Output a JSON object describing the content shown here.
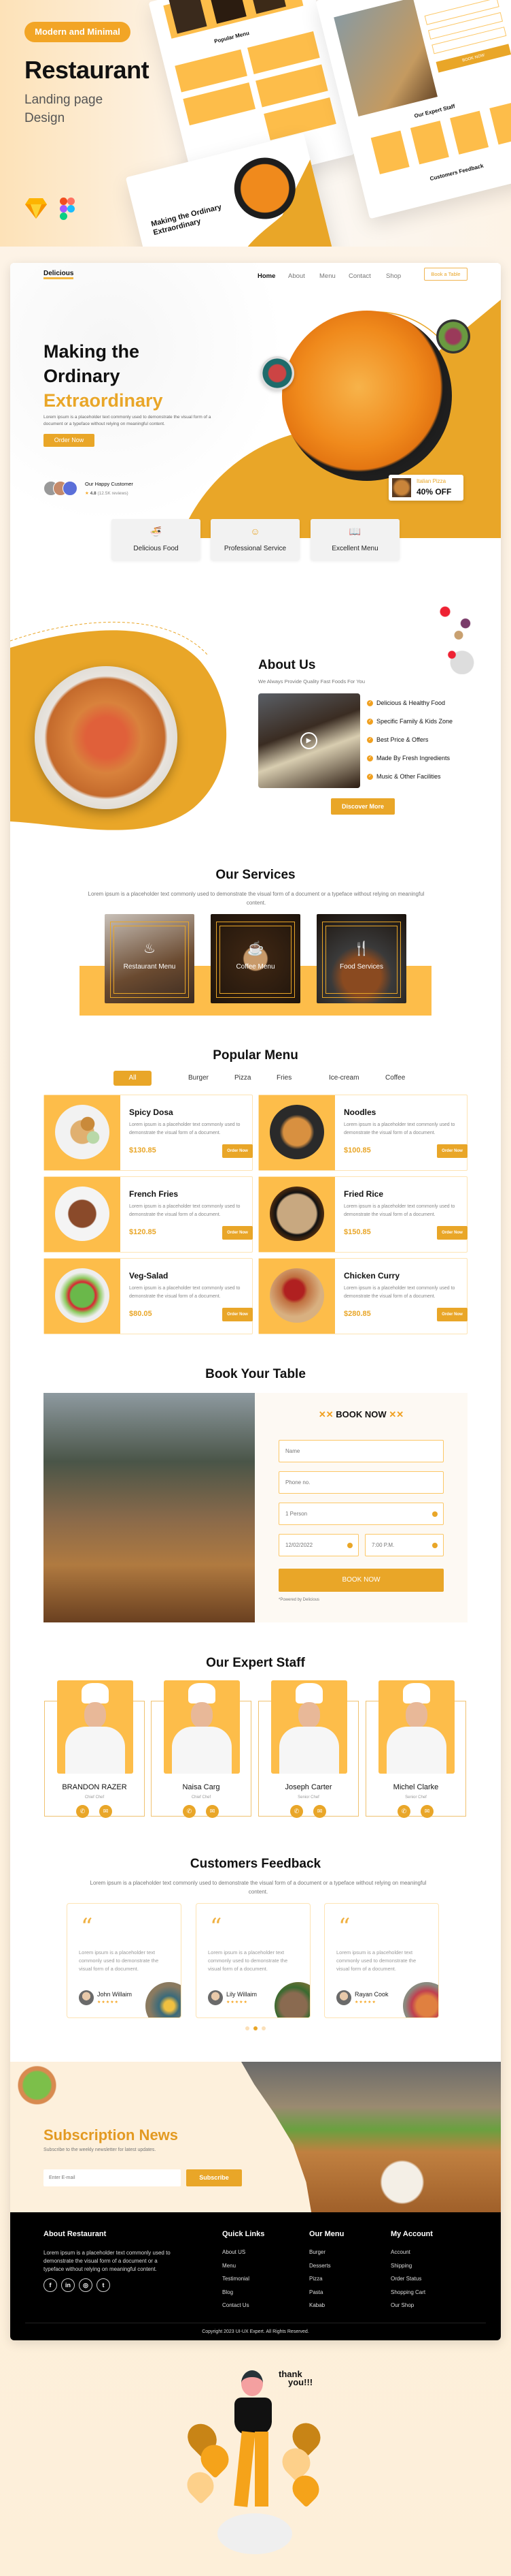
{
  "banner": {
    "badge": "Modern and Minimal",
    "title": "Restaurant",
    "subtitle_line1": "Landing page",
    "subtitle_line2": "Design",
    "tool_icons": [
      "sketch-icon",
      "figma-icon"
    ],
    "mockup_labels": {
      "popular_menu": "Popular Menu",
      "expert_staff": "Our Expert Staff",
      "feedback": "Customers Feedback",
      "book_now": "BOOK NOW",
      "hero": "Making the Ordinary Extraordinary"
    }
  },
  "colors": {
    "accent": "#e9a628",
    "yellow": "#fdbd4a",
    "cream": "#fdf1e0",
    "footer": "#000000"
  },
  "nav": {
    "logo": "Delicious",
    "links": [
      "Home",
      "About",
      "Menu",
      "Contact",
      "Shop"
    ],
    "active": "Home",
    "cta": "Book a Table"
  },
  "hero": {
    "title_line1": "Making the",
    "title_line2": "Ordinary",
    "title_highlight": "Extraordinary",
    "description": "Lorem ipsum is a placeholder text commonly used to demonstrate the visual form of a document or a typeface without relying on meaningful content.",
    "cta": "Order Now",
    "customers_label": "Our Happy Customer",
    "rating": "4.8",
    "reviews": "(12.5K reviews)",
    "promo_title": "Italian Pizza",
    "promo_discount": "40% OFF",
    "features": [
      {
        "label": "Delicious Food",
        "icon": "noodle-bowl-icon"
      },
      {
        "label": "Professional Service",
        "icon": "waiter-icon"
      },
      {
        "label": "Excellent Menu",
        "icon": "menu-book-icon"
      }
    ]
  },
  "about": {
    "title": "About Us",
    "subtitle": "We Always Provide Quality Fast Foods For You",
    "points": [
      "Delicious & Healthy Food",
      "Specific Family & Kids Zone",
      "Best Price & Offers",
      "Made By Fresh Ingredients",
      "Music & Other Facilities"
    ],
    "cta": "Discover More"
  },
  "services": {
    "title": "Our Services",
    "description": "Lorem ipsum is a placeholder text commonly used to demonstrate the visual form of a document or a typeface without relying on meaningful content.",
    "items": [
      {
        "label": "Restaurant Menu",
        "icon": "serving-dish-icon"
      },
      {
        "label": "Coffee Menu",
        "icon": "coffee-cup-icon"
      },
      {
        "label": "Food Services",
        "icon": "fork-knife-icon"
      }
    ]
  },
  "menu": {
    "title": "Popular Menu",
    "tabs": [
      "All",
      "Burger",
      "Pizza",
      "Fries",
      "Ice-cream",
      "Coffee"
    ],
    "active_tab": "All",
    "order_label": "Order Now",
    "items": [
      {
        "name": "Spicy Dosa",
        "description": "Lorem ipsum is a placeholder text commonly used to demonstrate the visual form of a document.",
        "price": "$130.85"
      },
      {
        "name": "Noodles",
        "description": "Lorem ipsum is a placeholder text commonly used to demonstrate the visual form of a document.",
        "price": "$100.85"
      },
      {
        "name": "French Fries",
        "description": "Lorem ipsum is a placeholder text commonly used to demonstrate the visual form of a document.",
        "price": "$120.85"
      },
      {
        "name": "Fried Rice",
        "description": "Lorem ipsum is a placeholder text commonly used to demonstrate the visual form of a document.",
        "price": "$150.85"
      },
      {
        "name": "Veg-Salad",
        "description": "Lorem ipsum is a placeholder text commonly used to demonstrate the visual form of a document.",
        "price": "$80.05"
      },
      {
        "name": "Chicken Curry",
        "description": "Lorem ipsum is a placeholder text commonly used to demonstrate the visual form of a document.",
        "price": "$280.85"
      }
    ]
  },
  "booking": {
    "title": "Book Your Table",
    "form_title": "BOOK NOW",
    "name_placeholder": "Name",
    "phone_placeholder": "Phone no.",
    "persons": "1 Person",
    "date": "12/02/2022",
    "time": "7:00 P.M.",
    "submit": "BOOK NOW",
    "powered": "*Powered by Delicious"
  },
  "staff": {
    "title": "Our Expert Staff",
    "members": [
      {
        "name": "BRANDON RAZER",
        "role": "Chief Chef"
      },
      {
        "name": "Naisa Carg",
        "role": "Chief Chef"
      },
      {
        "name": "Joseph Carter",
        "role": "Senior Chef"
      },
      {
        "name": "Michel Clarke",
        "role": "Senior Chef"
      }
    ]
  },
  "feedback": {
    "title": "Customers Feedback",
    "description": "Lorem ipsum is a placeholder text commonly used to demonstrate the visual form of a document or a typeface without relying on meaningful content.",
    "reviews": [
      {
        "text": "Lorem ipsum is a placeholder text commonly used to demonstrate the visual form of a document.",
        "name": "John Willaim",
        "stars": 5
      },
      {
        "text": "Lorem ipsum is a placeholder text commonly used to demonstrate the visual form of a document.",
        "name": "Lily Willaim",
        "stars": 5
      },
      {
        "text": "Lorem ipsum is a placeholder text commonly used to demonstrate the visual form of a document.",
        "name": "Rayan Cook",
        "stars": 5
      }
    ],
    "active_dot": 2,
    "dot_count": 3
  },
  "subscription": {
    "title": "Subscription News",
    "subtitle": "Subscribe to  the weekly newsletter for latest updates.",
    "email_placeholder": "Enter E-mail",
    "button": "Subscribe"
  },
  "footer": {
    "about_title": "About Restaurant",
    "about_text": "Lorem ipsum is a placeholder text commonly used to demonstrate the visual form of a document or a typeface without relying on meaningful content.",
    "socials": [
      "facebook-icon",
      "linkedin-icon",
      "instagram-icon",
      "twitter-icon"
    ],
    "columns": [
      {
        "title": "Quick Links",
        "links": [
          "About US",
          "Menu",
          "Testimonial",
          "Blog",
          "Contact Us"
        ]
      },
      {
        "title": "Our Menu",
        "links": [
          "Burger",
          "Desserts",
          "Pizza",
          "Pasta",
          "Kabab"
        ]
      },
      {
        "title": "My Account",
        "links": [
          "Account",
          "Shipping",
          "Order Status",
          "Shopping Cart",
          "Our Shop"
        ]
      }
    ],
    "copyright": "Copyright 2023 UI-UX Expert. All Rights Reserved."
  },
  "thanks": {
    "text_line1": "thank",
    "text_line2": "you!!!"
  }
}
